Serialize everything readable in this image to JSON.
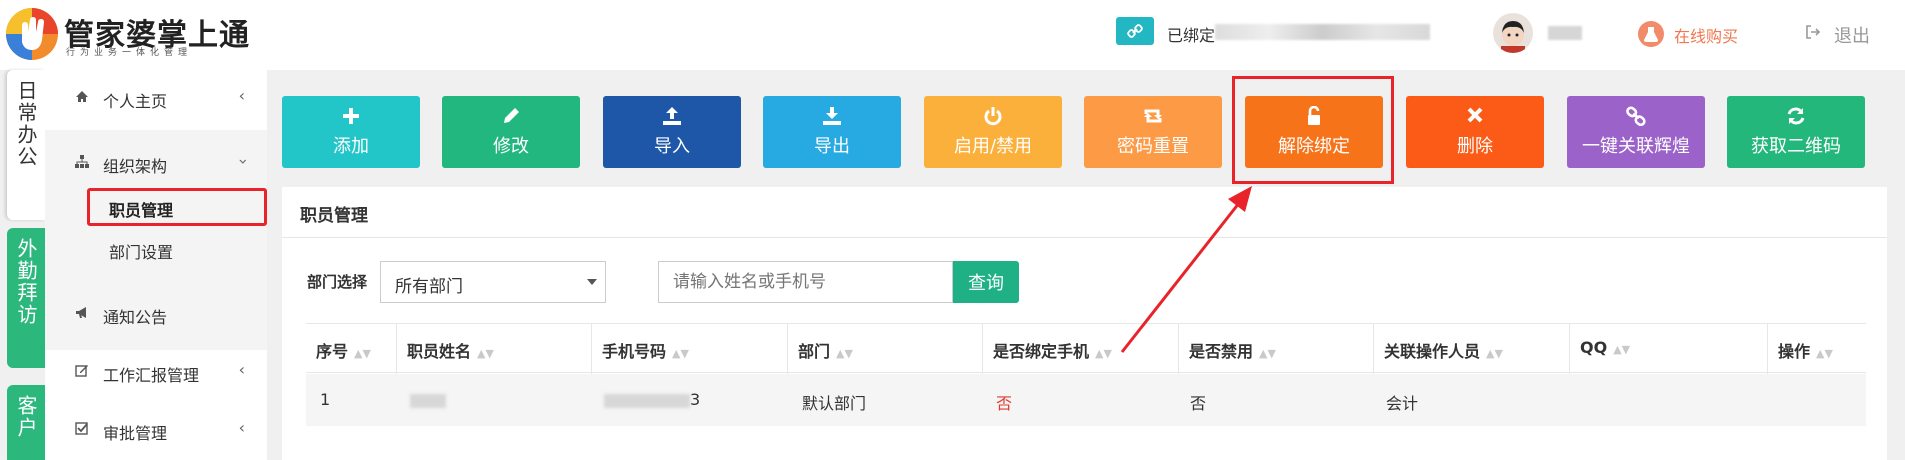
{
  "header": {
    "brand_title": "管家婆掌上通",
    "brand_subtitle": "行为业务一体化管理",
    "bind_label": "已绑定",
    "buy_label": "在线购买",
    "logout_label": "退出"
  },
  "vertical_tabs": [
    {
      "label": "日常办公"
    },
    {
      "label": "外勤拜访"
    },
    {
      "label": "客户"
    }
  ],
  "sidebar": {
    "items": [
      {
        "label": "个人主页"
      },
      {
        "label": "组织架构"
      },
      {
        "label": "通知公告"
      },
      {
        "label": "工作汇报管理"
      },
      {
        "label": "审批管理"
      }
    ],
    "sub_items": [
      {
        "label": "职员管理"
      },
      {
        "label": "部门设置"
      }
    ]
  },
  "toolbar": {
    "buttons": [
      {
        "label": "添加",
        "icon": "plus-icon",
        "color": "#23c6c8"
      },
      {
        "label": "修改",
        "icon": "pencil-icon",
        "color": "#22b77f"
      },
      {
        "label": "导入",
        "icon": "upload-icon",
        "color": "#1f57a8"
      },
      {
        "label": "导出",
        "icon": "download-icon",
        "color": "#27a9e1"
      },
      {
        "label": "启用/禁用",
        "icon": "power-icon",
        "color": "#fbb03b"
      },
      {
        "label": "密码重置",
        "icon": "retweet-icon",
        "color": "#fd9a46"
      },
      {
        "label": "解除绑定",
        "icon": "unlock-icon",
        "color": "#f7731a"
      },
      {
        "label": "删除",
        "icon": "close-icon",
        "color": "#fb5b16"
      },
      {
        "label": "一键关联辉煌",
        "icon": "link-icon",
        "color": "#9b62c9"
      },
      {
        "label": "获取二维码",
        "icon": "refresh-icon",
        "color": "#23b77c"
      }
    ]
  },
  "panel": {
    "title": "职员管理",
    "filter_label": "部门选择",
    "dept_selected": "所有部门",
    "search_placeholder": "请输入姓名或手机号",
    "search_button": "查询"
  },
  "table": {
    "columns": [
      "序号",
      "职员姓名",
      "手机号码",
      "部门",
      "是否绑定手机",
      "是否禁用",
      "关联操作人员",
      "QQ",
      "操作"
    ],
    "rows": [
      {
        "index": "1",
        "phone_tail": "3",
        "dept": "默认部门",
        "bound": "否",
        "disabled": "否",
        "operator": "会计"
      }
    ]
  },
  "colors": {
    "accent_green": "#1fb185",
    "highlight_red": "#e8242a",
    "negative_red": "#e03c31"
  }
}
